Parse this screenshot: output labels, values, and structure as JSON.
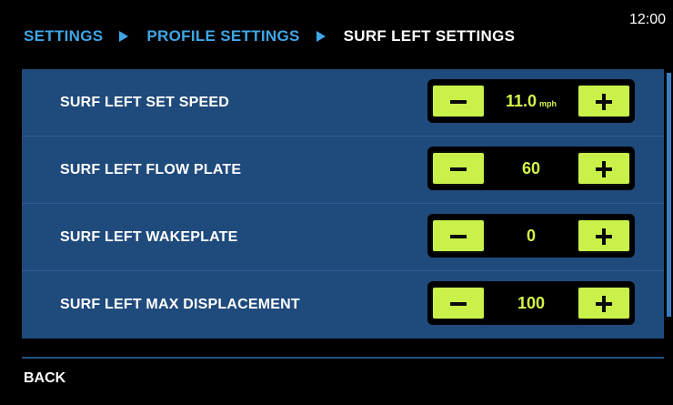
{
  "header": {
    "breadcrumb": [
      "SETTINGS",
      "PROFILE SETTINGS",
      "SURF LEFT SETTINGS"
    ],
    "clock": "12:00"
  },
  "settings": [
    {
      "label": "SURF LEFT SET SPEED",
      "value": "11.0",
      "unit": "mph"
    },
    {
      "label": "SURF LEFT FLOW PLATE",
      "value": "60",
      "unit": ""
    },
    {
      "label": "SURF LEFT WAKEPLATE",
      "value": "0",
      "unit": ""
    },
    {
      "label": "SURF LEFT MAX DISPLACEMENT",
      "value": "100",
      "unit": ""
    }
  ],
  "footer": {
    "back_label": "BACK"
  },
  "colors": {
    "panel": "#1f4a7c",
    "accent_blue": "#3fa6e6",
    "button_green": "#c9f14a",
    "value_yellow": "#d4f54a"
  },
  "icons": {
    "minus": "minus-icon",
    "plus": "plus-icon",
    "separator": "triangle-right-icon"
  }
}
